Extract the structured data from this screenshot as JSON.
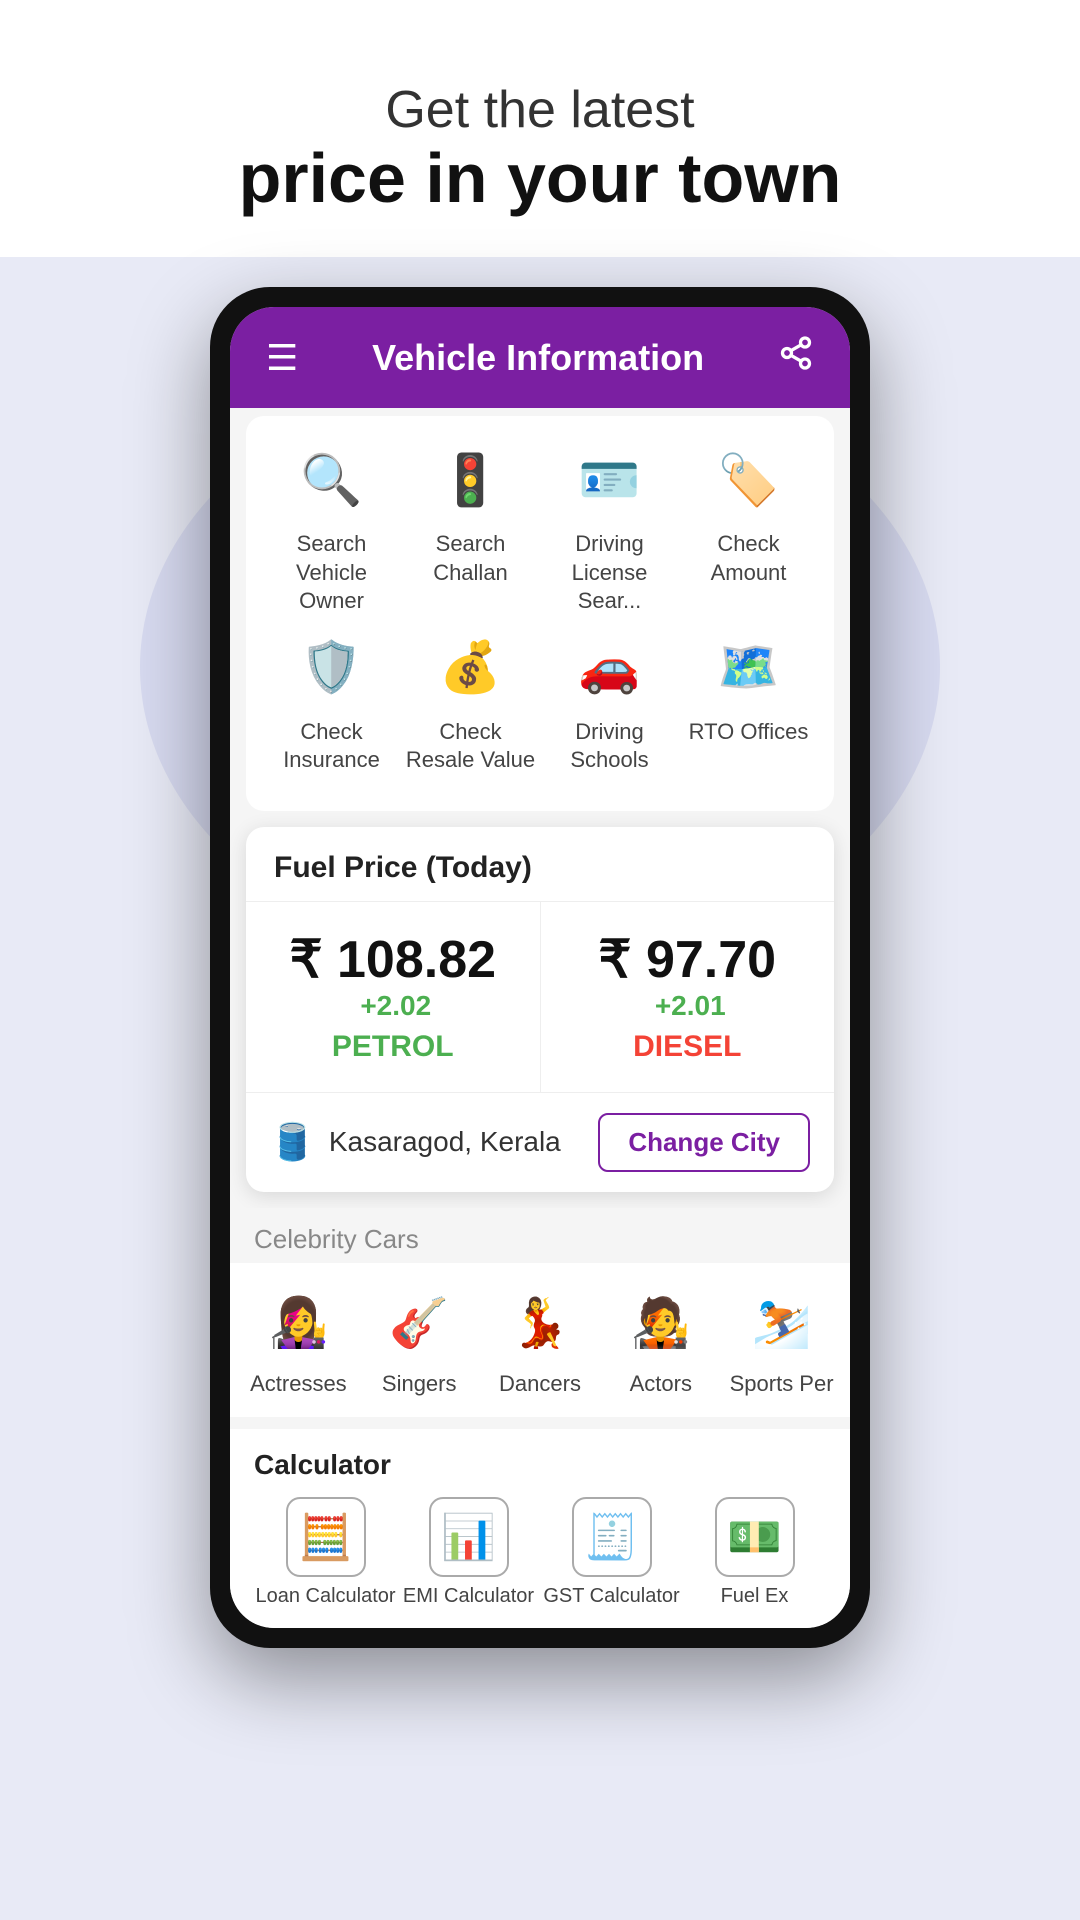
{
  "hero": {
    "subtitle": "Get the latest",
    "title": "price in your town"
  },
  "app": {
    "header_title": "Vehicle Information",
    "menu_icon": "☰",
    "share_icon": "⬆"
  },
  "grid_row1": [
    {
      "id": "search-vehicle-owner",
      "label": "Search Vehicle Owner",
      "icon": "🔍"
    },
    {
      "id": "search-challan",
      "label": "Search Challan",
      "icon": "🚦"
    },
    {
      "id": "driving-license",
      "label": "Driving License Sear...",
      "icon": "🪪"
    },
    {
      "id": "check-amount",
      "label": "Check Amount",
      "icon": "🏷️"
    }
  ],
  "grid_row2": [
    {
      "id": "check-insurance",
      "label": "Check Insurance",
      "icon": "🛡️"
    },
    {
      "id": "check-resale-value",
      "label": "Check Resale Value",
      "icon": "💰"
    },
    {
      "id": "driving-schools",
      "label": "Driving Schools",
      "icon": "🚗"
    },
    {
      "id": "rto-offices",
      "label": "RTO Offices",
      "icon": "🗺️"
    }
  ],
  "fuel": {
    "title": "Fuel Price (Today)",
    "petrol_amount": "₹ 108.82",
    "petrol_change": "+2.02",
    "petrol_label": "PETROL",
    "diesel_amount": "₹ 97.70",
    "diesel_change": "+2.01",
    "diesel_label": "DIESEL",
    "city": "Kasaragod, Kerala",
    "change_city_btn": "Change City"
  },
  "celebrity": {
    "section_label": "Celebrity Cars",
    "items": [
      {
        "id": "actresses",
        "label": "Actresses",
        "icon": "👩‍🎤"
      },
      {
        "id": "singers",
        "label": "Singers",
        "icon": "🎸"
      },
      {
        "id": "dancers",
        "label": "Dancers",
        "icon": "💃"
      },
      {
        "id": "actors",
        "label": "Actors",
        "icon": "🧑‍🎤"
      },
      {
        "id": "sports-persons",
        "label": "Sports Per",
        "icon": "⛷️"
      }
    ]
  },
  "calculator": {
    "title": "Calculator",
    "items": [
      {
        "id": "loan-calculator",
        "label": "Loan Calculator",
        "icon": "🧮"
      },
      {
        "id": "emi-calculator",
        "label": "EMI Calculator",
        "icon": "📊"
      },
      {
        "id": "gst-calculator",
        "label": "GST Calculator",
        "icon": "🧾"
      },
      {
        "id": "fuel-ex",
        "label": "Fuel Ex",
        "icon": "💵"
      }
    ]
  }
}
